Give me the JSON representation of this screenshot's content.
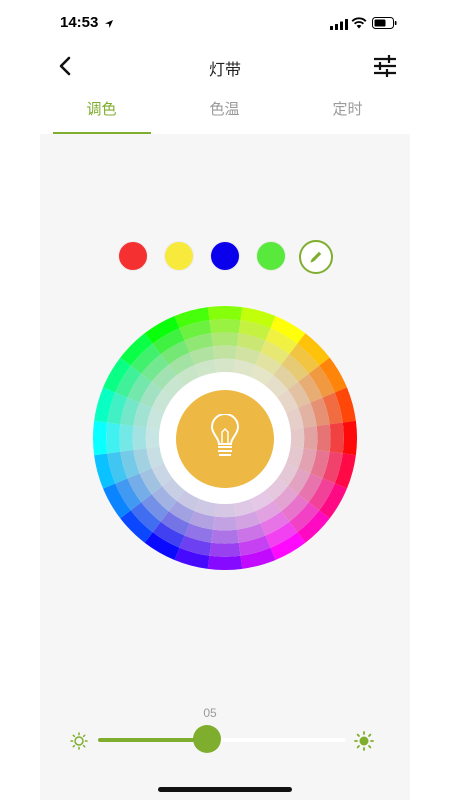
{
  "status_bar": {
    "time": "14:53"
  },
  "nav": {
    "title": "灯带"
  },
  "tabs": [
    {
      "label": "调色",
      "active": true
    },
    {
      "label": "色温",
      "active": false
    },
    {
      "label": "定时",
      "active": false
    }
  ],
  "presets": [
    {
      "name": "red",
      "color": "#f53030"
    },
    {
      "name": "yellow",
      "color": "#f8ea3c"
    },
    {
      "name": "blue",
      "color": "#0b00ec"
    },
    {
      "name": "green",
      "color": "#59e83c"
    }
  ],
  "bulb": {
    "color": "#edb843"
  },
  "brightness": {
    "value_label": "05",
    "fraction": 0.44
  },
  "colors": {
    "accent": "#7fae2f",
    "content_bg": "#f6f6f6"
  }
}
